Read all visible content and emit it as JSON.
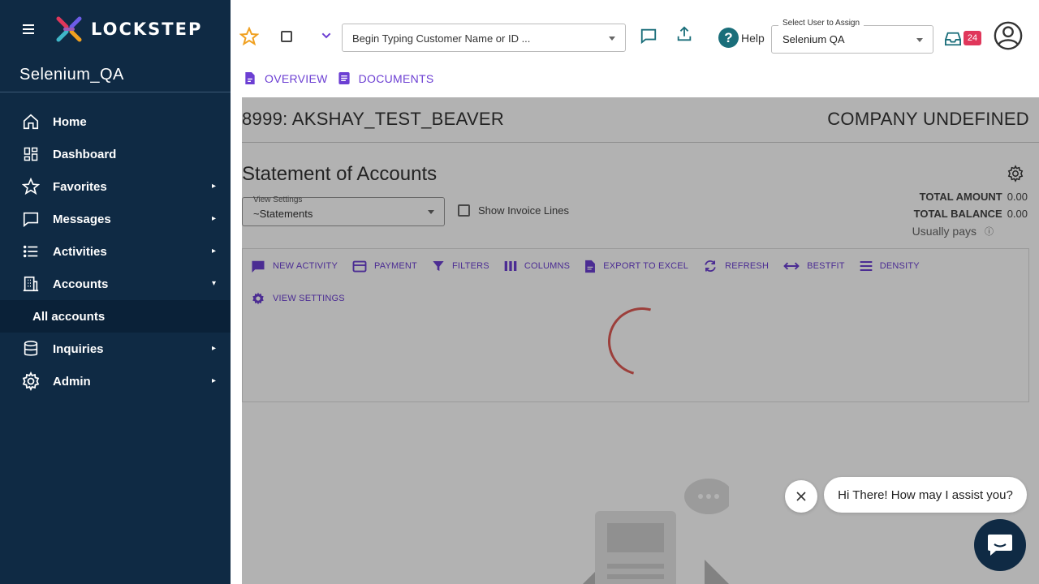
{
  "brand": {
    "logo_text": "LOCKSTEP"
  },
  "sidebar": {
    "org_name": "Selenium_QA",
    "items": [
      {
        "label": "Home",
        "icon": "home-icon"
      },
      {
        "label": "Dashboard",
        "icon": "dashboard-icon"
      },
      {
        "label": "Favorites",
        "icon": "star-icon",
        "chevron": "right"
      },
      {
        "label": "Messages",
        "icon": "message-icon",
        "chevron": "right"
      },
      {
        "label": "Activities",
        "icon": "list-icon",
        "chevron": "right"
      },
      {
        "label": "Accounts",
        "icon": "building-icon",
        "chevron": "down"
      },
      {
        "label": "All accounts",
        "sub": true
      },
      {
        "label": "Inquiries",
        "icon": "database-icon",
        "chevron": "right"
      },
      {
        "label": "Admin",
        "icon": "gear-icon",
        "chevron": "right"
      }
    ]
  },
  "topbar": {
    "customer_placeholder": "Begin Typing Customer Name or ID ...",
    "help_label": "Help",
    "assign_legend": "Select User to Assign",
    "assign_value": "Selenium QA",
    "inbox_count": "24",
    "tabs": [
      {
        "label": "OVERVIEW"
      },
      {
        "label": "DOCUMENTS"
      }
    ]
  },
  "main": {
    "account_title": "8999: AKSHAY_TEST_BEAVER",
    "company": "COMPANY UNDEFINED",
    "statement_title": "Statement of Accounts",
    "view_settings_legend": "View Settings",
    "view_settings_value": "~Statements",
    "show_invoice_lines": "Show Invoice Lines",
    "total_amount_label": "TOTAL AMOUNT",
    "total_amount_value": "0.00",
    "total_balance_label": "TOTAL BALANCE",
    "total_balance_value": "0.00",
    "usually_pays": "Usually pays",
    "toolbar": {
      "new_activity": "NEW ACTIVITY",
      "payment": "PAYMENT",
      "filters": "FILTERS",
      "columns": "COLUMNS",
      "export": "EXPORT TO EXCEL",
      "refresh": "REFRESH",
      "bestfit": "BESTFIT",
      "density": "DENSITY",
      "view_settings": "VIEW SETTINGS"
    }
  },
  "chat": {
    "greeting": "Hi There! How may I assist you?"
  },
  "colors": {
    "sidebar_bg": "#0f2a44",
    "accent_purple": "#6c3fd3",
    "teal": "#1a6e7a",
    "badge": "#e0375b",
    "star": "#f0a020"
  }
}
